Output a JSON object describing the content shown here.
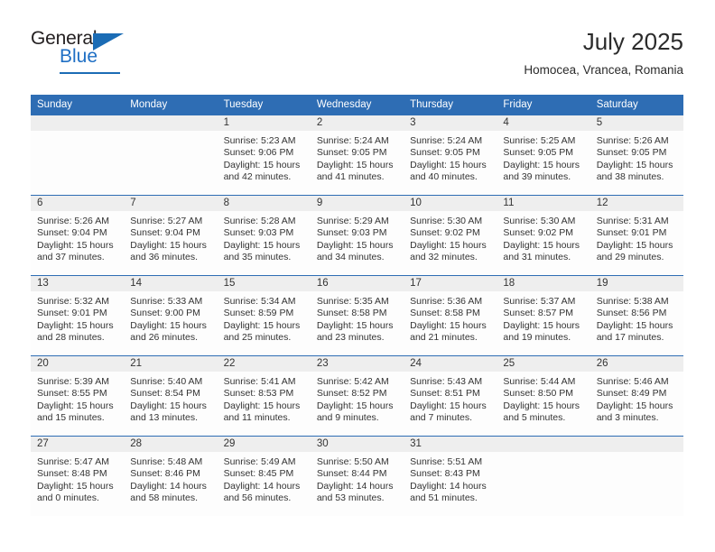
{
  "brand": {
    "name_part1": "General",
    "name_part2": "Blue"
  },
  "header": {
    "title": "July 2025",
    "subtitle": "Homocea, Vrancea, Romania"
  },
  "calendar": {
    "weekday_headers": [
      "Sunday",
      "Monday",
      "Tuesday",
      "Wednesday",
      "Thursday",
      "Friday",
      "Saturday"
    ],
    "accent_color": "#2e6db4",
    "date_band_color": "#eeeeee",
    "weeks": [
      [
        {
          "day": "",
          "sunrise": "",
          "sunset": "",
          "daylight_1": "",
          "daylight_2": ""
        },
        {
          "day": "",
          "sunrise": "",
          "sunset": "",
          "daylight_1": "",
          "daylight_2": ""
        },
        {
          "day": "1",
          "sunrise": "Sunrise: 5:23 AM",
          "sunset": "Sunset: 9:06 PM",
          "daylight_1": "Daylight: 15 hours",
          "daylight_2": "and 42 minutes."
        },
        {
          "day": "2",
          "sunrise": "Sunrise: 5:24 AM",
          "sunset": "Sunset: 9:05 PM",
          "daylight_1": "Daylight: 15 hours",
          "daylight_2": "and 41 minutes."
        },
        {
          "day": "3",
          "sunrise": "Sunrise: 5:24 AM",
          "sunset": "Sunset: 9:05 PM",
          "daylight_1": "Daylight: 15 hours",
          "daylight_2": "and 40 minutes."
        },
        {
          "day": "4",
          "sunrise": "Sunrise: 5:25 AM",
          "sunset": "Sunset: 9:05 PM",
          "daylight_1": "Daylight: 15 hours",
          "daylight_2": "and 39 minutes."
        },
        {
          "day": "5",
          "sunrise": "Sunrise: 5:26 AM",
          "sunset": "Sunset: 9:05 PM",
          "daylight_1": "Daylight: 15 hours",
          "daylight_2": "and 38 minutes."
        }
      ],
      [
        {
          "day": "6",
          "sunrise": "Sunrise: 5:26 AM",
          "sunset": "Sunset: 9:04 PM",
          "daylight_1": "Daylight: 15 hours",
          "daylight_2": "and 37 minutes."
        },
        {
          "day": "7",
          "sunrise": "Sunrise: 5:27 AM",
          "sunset": "Sunset: 9:04 PM",
          "daylight_1": "Daylight: 15 hours",
          "daylight_2": "and 36 minutes."
        },
        {
          "day": "8",
          "sunrise": "Sunrise: 5:28 AM",
          "sunset": "Sunset: 9:03 PM",
          "daylight_1": "Daylight: 15 hours",
          "daylight_2": "and 35 minutes."
        },
        {
          "day": "9",
          "sunrise": "Sunrise: 5:29 AM",
          "sunset": "Sunset: 9:03 PM",
          "daylight_1": "Daylight: 15 hours",
          "daylight_2": "and 34 minutes."
        },
        {
          "day": "10",
          "sunrise": "Sunrise: 5:30 AM",
          "sunset": "Sunset: 9:02 PM",
          "daylight_1": "Daylight: 15 hours",
          "daylight_2": "and 32 minutes."
        },
        {
          "day": "11",
          "sunrise": "Sunrise: 5:30 AM",
          "sunset": "Sunset: 9:02 PM",
          "daylight_1": "Daylight: 15 hours",
          "daylight_2": "and 31 minutes."
        },
        {
          "day": "12",
          "sunrise": "Sunrise: 5:31 AM",
          "sunset": "Sunset: 9:01 PM",
          "daylight_1": "Daylight: 15 hours",
          "daylight_2": "and 29 minutes."
        }
      ],
      [
        {
          "day": "13",
          "sunrise": "Sunrise: 5:32 AM",
          "sunset": "Sunset: 9:01 PM",
          "daylight_1": "Daylight: 15 hours",
          "daylight_2": "and 28 minutes."
        },
        {
          "day": "14",
          "sunrise": "Sunrise: 5:33 AM",
          "sunset": "Sunset: 9:00 PM",
          "daylight_1": "Daylight: 15 hours",
          "daylight_2": "and 26 minutes."
        },
        {
          "day": "15",
          "sunrise": "Sunrise: 5:34 AM",
          "sunset": "Sunset: 8:59 PM",
          "daylight_1": "Daylight: 15 hours",
          "daylight_2": "and 25 minutes."
        },
        {
          "day": "16",
          "sunrise": "Sunrise: 5:35 AM",
          "sunset": "Sunset: 8:58 PM",
          "daylight_1": "Daylight: 15 hours",
          "daylight_2": "and 23 minutes."
        },
        {
          "day": "17",
          "sunrise": "Sunrise: 5:36 AM",
          "sunset": "Sunset: 8:58 PM",
          "daylight_1": "Daylight: 15 hours",
          "daylight_2": "and 21 minutes."
        },
        {
          "day": "18",
          "sunrise": "Sunrise: 5:37 AM",
          "sunset": "Sunset: 8:57 PM",
          "daylight_1": "Daylight: 15 hours",
          "daylight_2": "and 19 minutes."
        },
        {
          "day": "19",
          "sunrise": "Sunrise: 5:38 AM",
          "sunset": "Sunset: 8:56 PM",
          "daylight_1": "Daylight: 15 hours",
          "daylight_2": "and 17 minutes."
        }
      ],
      [
        {
          "day": "20",
          "sunrise": "Sunrise: 5:39 AM",
          "sunset": "Sunset: 8:55 PM",
          "daylight_1": "Daylight: 15 hours",
          "daylight_2": "and 15 minutes."
        },
        {
          "day": "21",
          "sunrise": "Sunrise: 5:40 AM",
          "sunset": "Sunset: 8:54 PM",
          "daylight_1": "Daylight: 15 hours",
          "daylight_2": "and 13 minutes."
        },
        {
          "day": "22",
          "sunrise": "Sunrise: 5:41 AM",
          "sunset": "Sunset: 8:53 PM",
          "daylight_1": "Daylight: 15 hours",
          "daylight_2": "and 11 minutes."
        },
        {
          "day": "23",
          "sunrise": "Sunrise: 5:42 AM",
          "sunset": "Sunset: 8:52 PM",
          "daylight_1": "Daylight: 15 hours",
          "daylight_2": "and 9 minutes."
        },
        {
          "day": "24",
          "sunrise": "Sunrise: 5:43 AM",
          "sunset": "Sunset: 8:51 PM",
          "daylight_1": "Daylight: 15 hours",
          "daylight_2": "and 7 minutes."
        },
        {
          "day": "25",
          "sunrise": "Sunrise: 5:44 AM",
          "sunset": "Sunset: 8:50 PM",
          "daylight_1": "Daylight: 15 hours",
          "daylight_2": "and 5 minutes."
        },
        {
          "day": "26",
          "sunrise": "Sunrise: 5:46 AM",
          "sunset": "Sunset: 8:49 PM",
          "daylight_1": "Daylight: 15 hours",
          "daylight_2": "and 3 minutes."
        }
      ],
      [
        {
          "day": "27",
          "sunrise": "Sunrise: 5:47 AM",
          "sunset": "Sunset: 8:48 PM",
          "daylight_1": "Daylight: 15 hours",
          "daylight_2": "and 0 minutes."
        },
        {
          "day": "28",
          "sunrise": "Sunrise: 5:48 AM",
          "sunset": "Sunset: 8:46 PM",
          "daylight_1": "Daylight: 14 hours",
          "daylight_2": "and 58 minutes."
        },
        {
          "day": "29",
          "sunrise": "Sunrise: 5:49 AM",
          "sunset": "Sunset: 8:45 PM",
          "daylight_1": "Daylight: 14 hours",
          "daylight_2": "and 56 minutes."
        },
        {
          "day": "30",
          "sunrise": "Sunrise: 5:50 AM",
          "sunset": "Sunset: 8:44 PM",
          "daylight_1": "Daylight: 14 hours",
          "daylight_2": "and 53 minutes."
        },
        {
          "day": "31",
          "sunrise": "Sunrise: 5:51 AM",
          "sunset": "Sunset: 8:43 PM",
          "daylight_1": "Daylight: 14 hours",
          "daylight_2": "and 51 minutes."
        },
        {
          "day": "",
          "sunrise": "",
          "sunset": "",
          "daylight_1": "",
          "daylight_2": ""
        },
        {
          "day": "",
          "sunrise": "",
          "sunset": "",
          "daylight_1": "",
          "daylight_2": ""
        }
      ]
    ]
  }
}
